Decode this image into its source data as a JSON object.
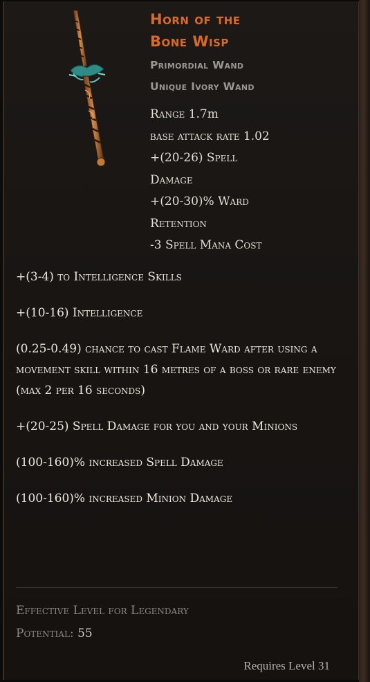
{
  "item": {
    "name_line1": "Horn of the",
    "name_line2": "Bone Wisp",
    "base_type": "Primordial Wand",
    "rarity_line": "Unique Ivory Wand",
    "icon": "wand-icon"
  },
  "implicits": [
    {
      "label": "Range",
      "value": " 1.7m"
    },
    {
      "label": "base attack rate",
      "value": " 1.02"
    },
    {
      "line1": "+(20-26) Spell",
      "line2": "Damage"
    },
    {
      "line1": "+(20-30)% Ward",
      "line2": "Retention"
    },
    {
      "text": "-3 Spell Mana Cost"
    }
  ],
  "mods": [
    "+(3-4) to Intelligence Skills",
    "+(10-16) Intelligence",
    "(0.25-0.49) chance to cast Flame Ward after using a movement skill within 16 metres of a boss or rare enemy (max 2 per 16 seconds)",
    "+(20-25) Spell Damage for you and your Minions",
    "(100-160)% increased Spell Damage",
    "(100-160)% increased Minion Damage"
  ],
  "footer": {
    "legendary_label_line1": "Effective Level for Legendary",
    "legendary_label_line2": "Potential: ",
    "legendary_value": "55",
    "requires": "Requires Level 31"
  },
  "colors": {
    "unique_name": "#d9692a",
    "base_text": "#9c9690",
    "mod_text": "#ece6dc",
    "footer_text": "#8d8780"
  }
}
